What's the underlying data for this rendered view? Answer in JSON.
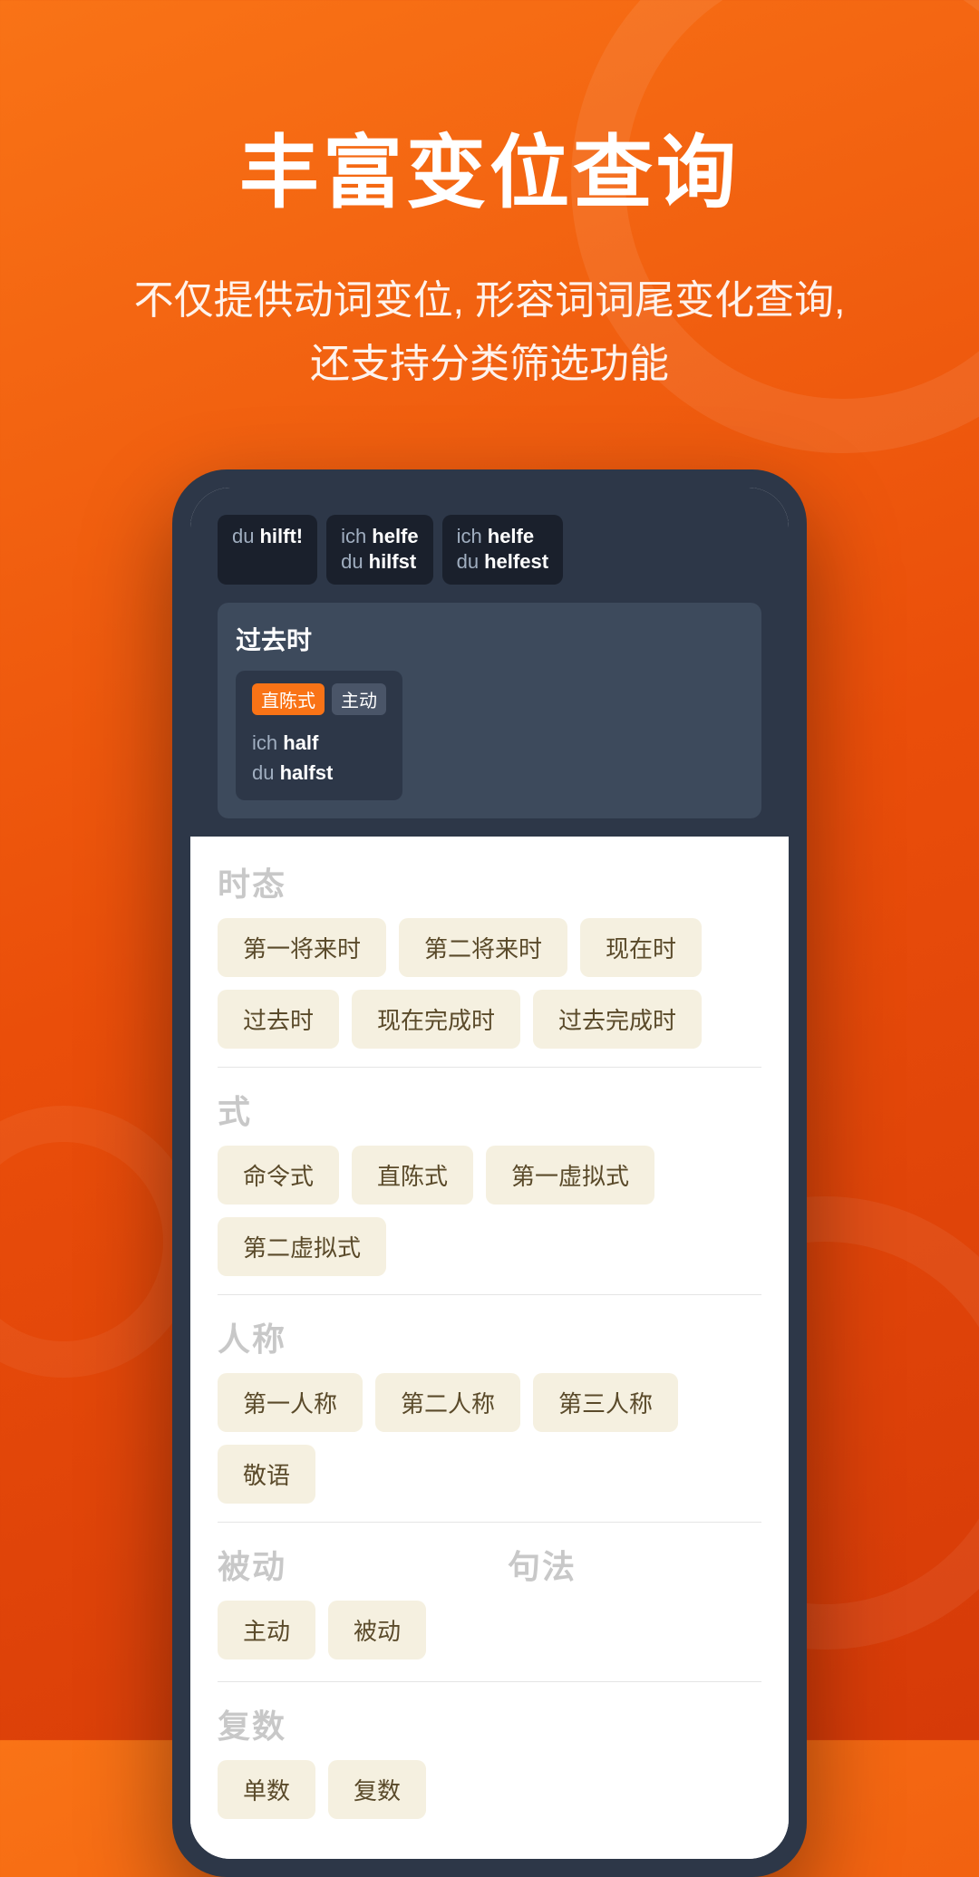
{
  "background": {
    "gradient_start": "#f97316",
    "gradient_end": "#d63a08"
  },
  "header": {
    "title": "丰富变位查询",
    "subtitle": "不仅提供动词变位, 形容词词尾变化查询,\n还支持分类筛选功能"
  },
  "app_screen": {
    "tooltips": [
      {
        "pronoun": "du",
        "verb": "hilft!"
      },
      {
        "pronoun": "ich",
        "verb": "helfe",
        "pronoun2": "du",
        "verb2": "hilfst"
      },
      {
        "pronoun": "ich",
        "verb": "helfe",
        "pronoun2": "du",
        "verb2": "helfest"
      }
    ],
    "past_tense_label": "过去时",
    "tags": {
      "tag1": "直陈式",
      "tag2": "主动"
    },
    "conjugation": {
      "line1_pron": "ich",
      "line1_verb": "half",
      "line2_pron": "du",
      "line2_verb": "halfst"
    },
    "filter_groups": [
      {
        "label": "时态",
        "tags": [
          "第一将来时",
          "第二将来时",
          "现在时",
          "过去时",
          "现在完成时",
          "过去完成时"
        ]
      },
      {
        "label": "式",
        "tags": [
          "命令式",
          "直陈式",
          "第一虚拟式",
          "第二虚拟式"
        ]
      },
      {
        "label": "人称",
        "tags": [
          "第一人称",
          "第二人称",
          "第三人称",
          "敬语"
        ]
      },
      {
        "label_left": "被动",
        "tags_left": [
          "主动",
          "被动"
        ],
        "label_right": "句法",
        "tags_right": []
      },
      {
        "label": "复数",
        "tags": [
          "单数",
          "复数"
        ]
      }
    ]
  }
}
